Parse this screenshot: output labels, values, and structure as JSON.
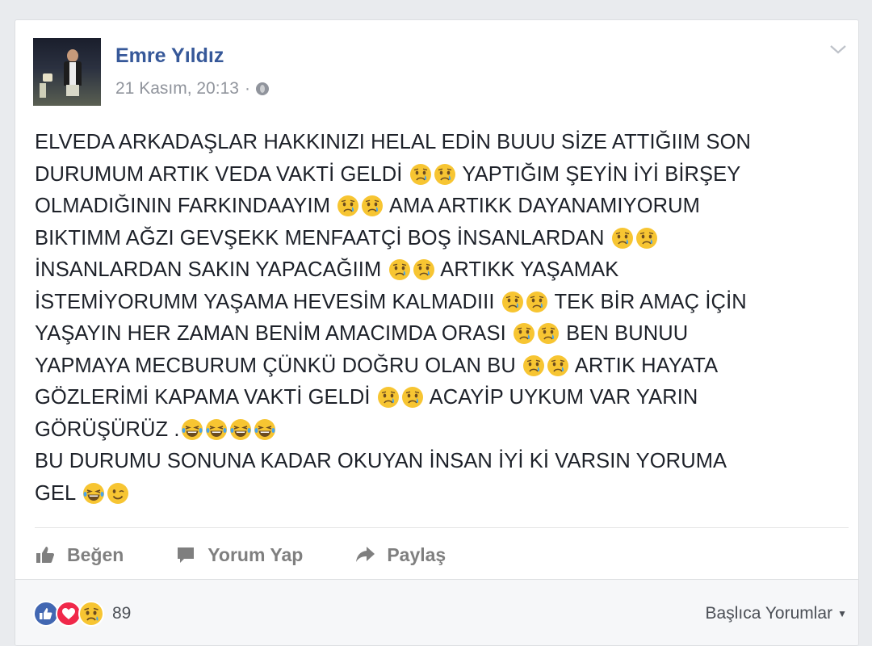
{
  "post": {
    "author": "Emre Yıldız",
    "timestamp": "21 Kasım, 20:13",
    "separator": "·",
    "privacy_icon": "globe-icon",
    "lines": [
      [
        {
          "t": "ELVEDA ARKADAŞLAR HAKKINIZI HELAL EDİN BUUU SİZE ATTIĞIIM SON"
        }
      ],
      [
        {
          "t": "DURUMUM ARTIK VEDA VAKTİ GELDİ "
        },
        {
          "e": "crying-face-icon"
        },
        {
          "e": "crying-face-icon"
        },
        {
          "t": " YAPTIĞIM ŞEYİN İYİ BİRŞEY"
        }
      ],
      [
        {
          "t": "OLMADIĞININ FARKINDAAYIM "
        },
        {
          "e": "crying-face-icon"
        },
        {
          "e": "crying-face-icon"
        },
        {
          "t": " AMA ARTIKK DAYANAMIYORUM"
        }
      ],
      [
        {
          "t": "BIKTIMM AĞZI GEVŞEKK MENFAATÇİ BOŞ İNSANLARDAN "
        },
        {
          "e": "crying-face-icon"
        },
        {
          "e": "crying-face-icon"
        }
      ],
      [
        {
          "t": "İNSANLARDAN SAKIN YAPACAĞIIM "
        },
        {
          "e": "crying-face-icon"
        },
        {
          "e": "crying-face-icon"
        },
        {
          "t": " ARTIKK YAŞAMAK"
        }
      ],
      [
        {
          "t": "İSTEMİYORUMM YAŞAMA HEVESİM KALMADIII "
        },
        {
          "e": "crying-face-icon"
        },
        {
          "e": "crying-face-icon"
        },
        {
          "t": " TEK BİR AMAÇ İÇİN"
        }
      ],
      [
        {
          "t": "YAŞAYIN HER ZAMAN BENİM AMACIMDA ORASI "
        },
        {
          "e": "crying-face-icon"
        },
        {
          "e": "crying-face-icon"
        },
        {
          "t": " BEN BUNUU"
        }
      ],
      [
        {
          "t": "YAPMAYA MECBURUM ÇÜNKÜ DOĞRU OLAN BU "
        },
        {
          "e": "crying-face-icon"
        },
        {
          "e": "crying-face-icon"
        },
        {
          "t": " ARTIK HAYATA"
        }
      ],
      [
        {
          "t": "GÖZLERİMİ KAPAMA VAKTİ GELDİ "
        },
        {
          "e": "crying-face-icon"
        },
        {
          "e": "crying-face-icon"
        },
        {
          "t": " ACAYİP UYKUM VAR YARIN"
        }
      ],
      [
        {
          "t": "GÖRÜŞÜRÜZ ."
        },
        {
          "e": "laughing-face-icon"
        },
        {
          "e": "laughing-face-icon"
        },
        {
          "e": "laughing-face-icon"
        },
        {
          "e": "laughing-face-icon"
        }
      ],
      [
        {
          "t": "BU DURUMU SONUNA KADAR OKUYAN İNSAN İYİ Kİ VARSIN YORUMA"
        }
      ],
      [
        {
          "t": "GEL "
        },
        {
          "e": "laughing-face-icon"
        },
        {
          "e": "winking-face-icon"
        }
      ]
    ]
  },
  "actions": {
    "like": {
      "label": "Beğen",
      "icon": "thumbs-up-icon"
    },
    "comment": {
      "label": "Yorum Yap",
      "icon": "comment-icon"
    },
    "share": {
      "label": "Paylaş",
      "icon": "share-arrow-icon"
    }
  },
  "reactions": {
    "icons": [
      "like-reaction-icon",
      "love-reaction-icon",
      "sad-reaction-icon"
    ],
    "count": "89"
  },
  "comments_sort": {
    "label": "Başlıca Yorumlar"
  },
  "colors": {
    "author_link": "#365899",
    "like_blue": "#4267b2",
    "love_red": "#f0284a",
    "emoji_yellow": "#f7c532",
    "text": "#1d2129",
    "muted": "#90949c"
  }
}
